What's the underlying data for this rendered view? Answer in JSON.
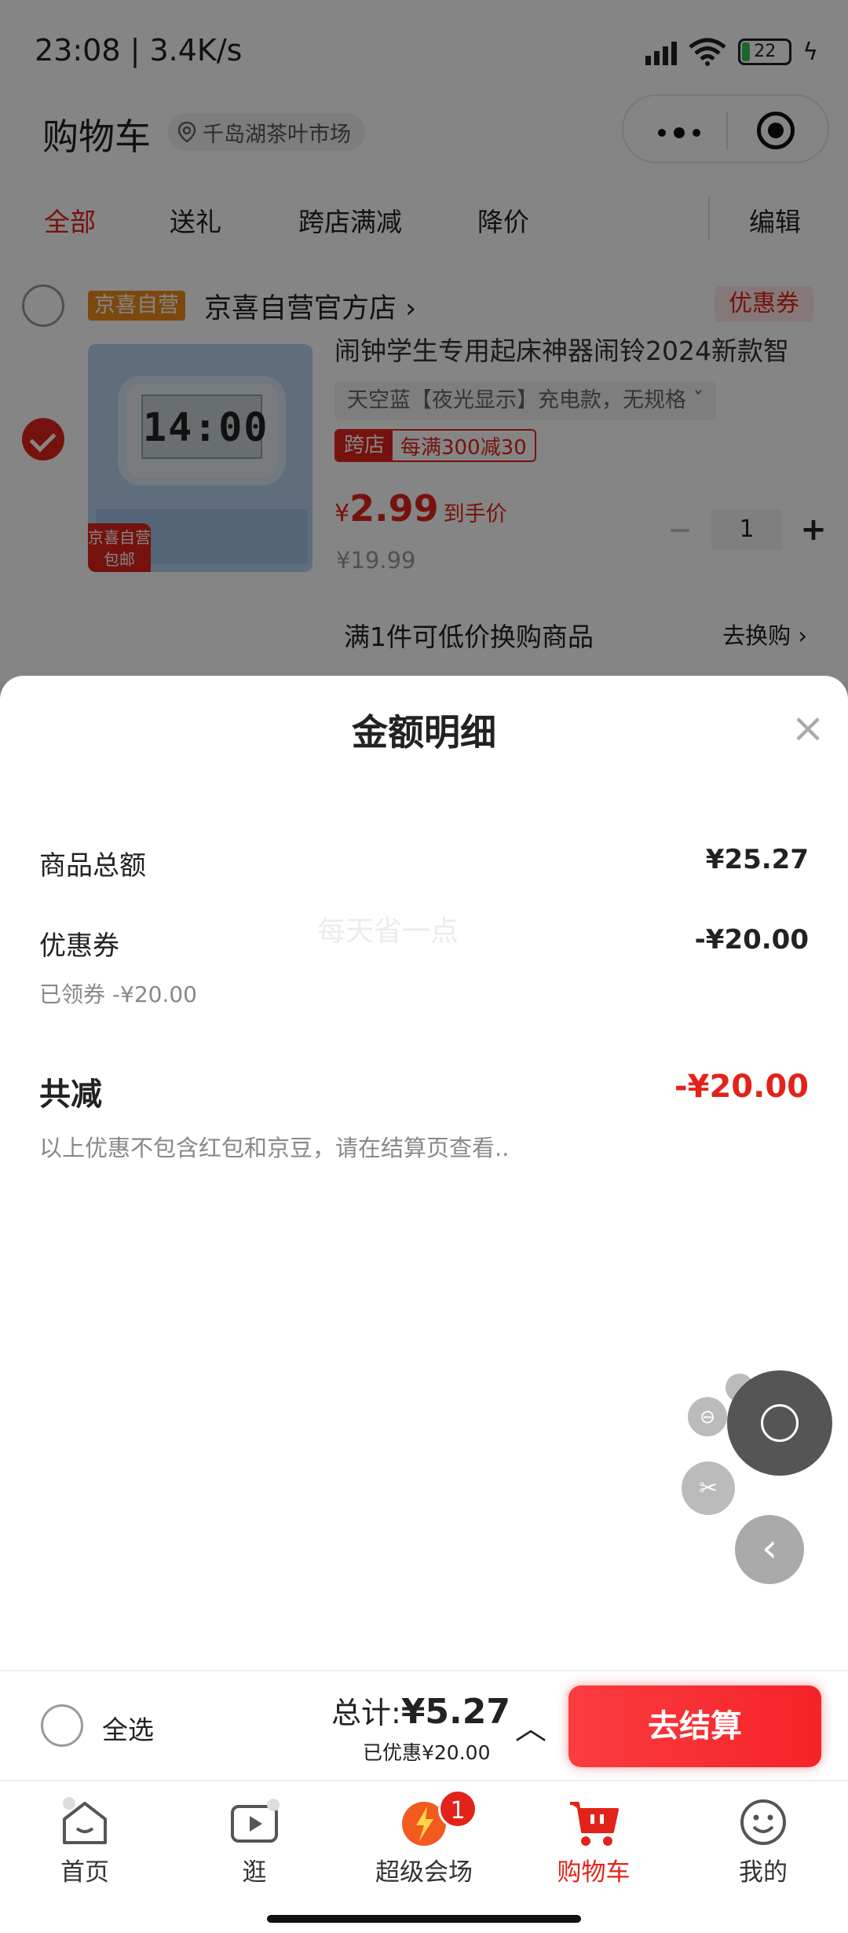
{
  "status_bar": {
    "time_speed": "23:08 | 3.4K/s",
    "battery": "22",
    "icons": [
      "hd-signal-icon",
      "wifi-icon",
      "battery-icon",
      "charging-bolt-icon"
    ]
  },
  "header": {
    "title": "购物车",
    "location": "千岛湖茶叶市场"
  },
  "filters": {
    "items": [
      "全部",
      "送礼",
      "跨店满减",
      "降价"
    ],
    "active": "全部",
    "edit_label": "编辑"
  },
  "shop": {
    "tag": "京喜自营",
    "name": "京喜自营官方店 ›",
    "coupon_label": "优惠券"
  },
  "product": {
    "title": "闹钟学生专用起床神器闹铃2024新款智",
    "spec": "天空蓝【夜光显示】充电款，无规格  ˇ",
    "promo_tag": "跨店",
    "promo_text": "每满300减30",
    "price_symbol": "¥",
    "price": "2.99",
    "price_note": "到手价",
    "original_price": "¥19.99",
    "image_badge": "京喜自营 包邮",
    "clock_display": "14:00",
    "quantity": "1",
    "minus": "−",
    "plus": "+"
  },
  "swap": {
    "text": "满1件可低价换购商品",
    "link": "去换购 ›"
  },
  "sheet": {
    "title": "金额明细",
    "close": "×",
    "watermark": "每天省一点",
    "rows": {
      "goods_label": "商品总额",
      "goods_value": "¥25.27",
      "coupon_label": "优惠券",
      "coupon_value": "-¥20.00",
      "coupon_sub": "已领券 -¥20.00"
    },
    "total_label": "共减",
    "total_value": "-¥20.00",
    "note": "以上优惠不包含红包和京豆，请在结算页查看.."
  },
  "actionbar": {
    "select_all": "全选",
    "total_prefix": "总计:",
    "total_amount": "¥5.27",
    "saved": "已优惠¥20.00",
    "caret": "︿",
    "checkout": "去结算"
  },
  "tabbar": {
    "items": [
      {
        "label": "首页",
        "icon": "home-icon"
      },
      {
        "label": "逛",
        "icon": "video-play-icon"
      },
      {
        "label": "超级会场",
        "icon": "super-venue-icon",
        "badge": "1"
      },
      {
        "label": "购物车",
        "icon": "cart-icon",
        "active": true
      },
      {
        "label": "我的",
        "icon": "profile-smile-icon"
      }
    ]
  },
  "colors": {
    "accent": "#e2231a",
    "checkout": "#f52328"
  }
}
